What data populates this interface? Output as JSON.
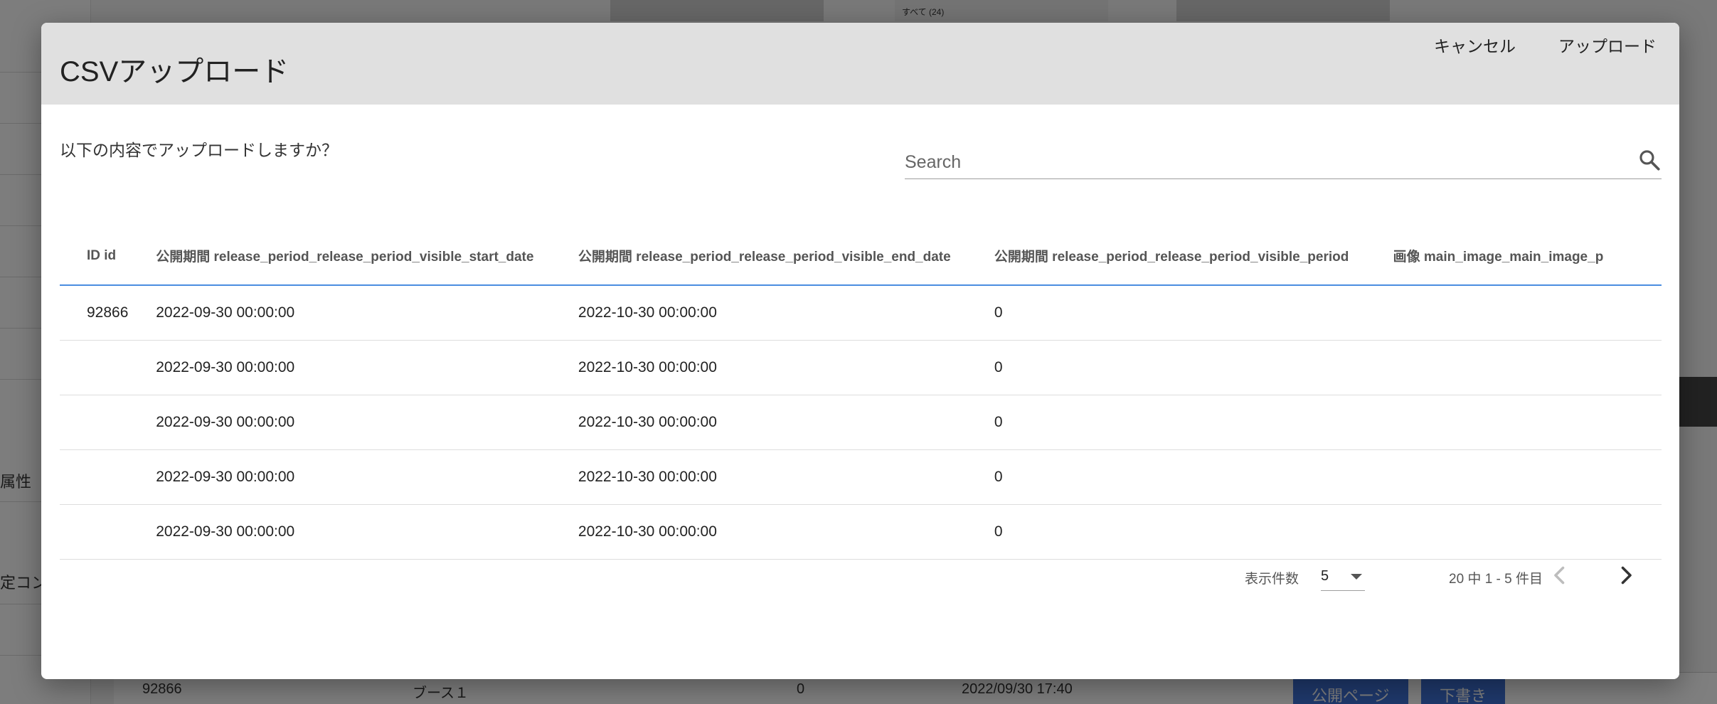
{
  "background": {
    "left_fragments": [
      "属性",
      "定コン"
    ],
    "top_fragment": "すべて (24)",
    "bottom_row": {
      "id": "92866",
      "name": "ブース１",
      "value": "0",
      "datetime": "2022/09/30 17:40"
    },
    "buttons": [
      "公開ページ",
      "下書き"
    ]
  },
  "dialog": {
    "title": "CSVアップロード",
    "prompt": "以下の内容でアップロードしますか？",
    "search": {
      "placeholder": "Search",
      "value": ""
    },
    "columns": [
      "ID id",
      "公開期間 release_period_release_period_visible_start_date",
      "公開期間 release_period_release_period_visible_end_date",
      "公開期間 release_period_release_period_visible_period",
      "画像 main_image_main_image_p"
    ],
    "rows": [
      [
        "92866",
        "2022-09-30 00:00:00",
        "2022-10-30 00:00:00",
        "0",
        ""
      ],
      [
        "",
        "2022-09-30 00:00:00",
        "2022-10-30 00:00:00",
        "0",
        ""
      ],
      [
        "",
        "2022-09-30 00:00:00",
        "2022-10-30 00:00:00",
        "0",
        ""
      ],
      [
        "",
        "2022-09-30 00:00:00",
        "2022-10-30 00:00:00",
        "0",
        ""
      ],
      [
        "",
        "2022-09-30 00:00:00",
        "2022-10-30 00:00:00",
        "0",
        ""
      ]
    ],
    "pagination": {
      "rows_per_page_label": "表示件数",
      "rows_per_page_value": "5",
      "range_text": "20 中 1 - 5 件目"
    },
    "actions": {
      "cancel_label": "キャンセル",
      "upload_label": "アップロード"
    }
  }
}
